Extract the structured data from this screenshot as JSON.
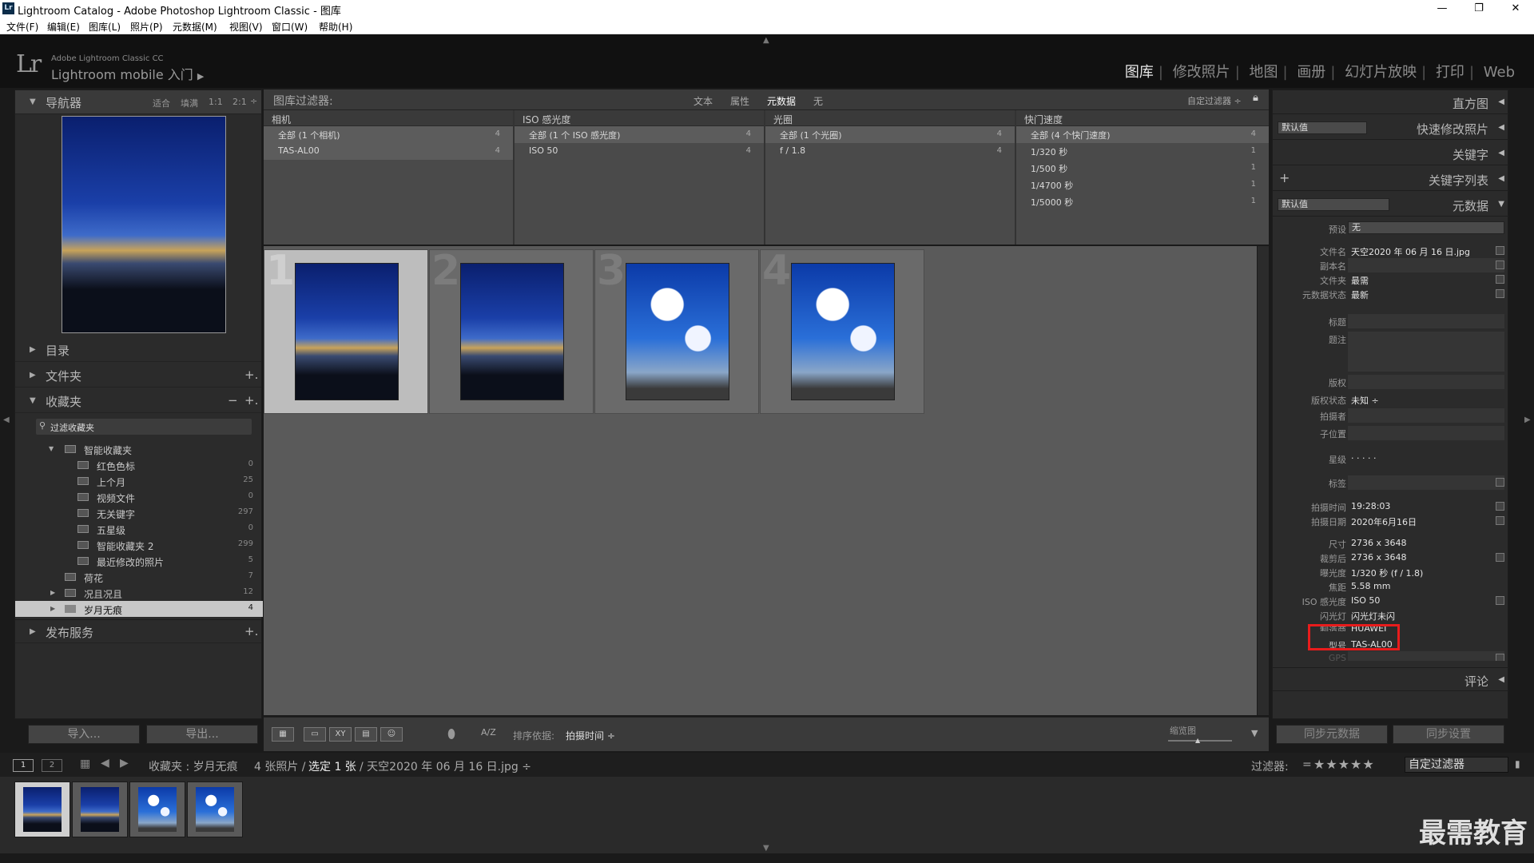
{
  "window": {
    "title": "Lightroom Catalog - Adobe Photoshop Lightroom Classic - 图库",
    "app_badge": "Lr",
    "minimize": "—",
    "restore": "❐",
    "close": "✕"
  },
  "menu": [
    "文件(F)",
    "编辑(E)",
    "图库(L)",
    "照片(P)",
    "元数据(M)",
    "视图(V)",
    "窗口(W)",
    "帮助(H)"
  ],
  "identity": {
    "logo": "Lr",
    "product": "Adobe Lightroom Classic CC",
    "main": "Lightroom mobile 入门",
    "arrow": "▶"
  },
  "modules": [
    "图库",
    "修改照片",
    "地图",
    "画册",
    "幻灯片放映",
    "打印",
    "Web"
  ],
  "modules_sep": "|",
  "left": {
    "navigator": {
      "title": "导航器",
      "zoom": [
        "适合",
        "填满",
        "1:1",
        "2:1"
      ],
      "zoom_arrow": "÷"
    },
    "catalog": "目录",
    "folders": "文件夹",
    "collections": "收藏夹",
    "collections_actions": [
      "−",
      "+."
    ],
    "folders_add": "+.",
    "filter_placeholder": "过滤收藏夹",
    "smart_group": "智能收藏夹",
    "smart_items": [
      {
        "label": "红色色标",
        "count": "0"
      },
      {
        "label": "上个月",
        "count": "25"
      },
      {
        "label": "视频文件",
        "count": "0"
      },
      {
        "label": "无关键字",
        "count": "297"
      },
      {
        "label": "五星级",
        "count": "0"
      },
      {
        "label": "智能收藏夹 2",
        "count": "299"
      },
      {
        "label": "最近修改的照片",
        "count": "5"
      }
    ],
    "other_items": [
      {
        "label": "荷花",
        "count": "7"
      },
      {
        "label": "况且况且",
        "count": "12"
      },
      {
        "label": "岁月无痕",
        "count": "4"
      }
    ],
    "publish": "发布服务",
    "publish_add": "+.",
    "import_btn": "导入...",
    "export_btn": "导出..."
  },
  "filter": {
    "title": "图库过滤器:",
    "tabs": [
      "文本",
      "属性",
      "元数据",
      "无"
    ],
    "custom": "自定过滤器 ÷",
    "columns": [
      {
        "head": "相机",
        "items": [
          {
            "label": "全部 (1 个相机)",
            "count": "4"
          },
          {
            "label": "TAS-AL00",
            "count": "4"
          }
        ]
      },
      {
        "head": "ISO 感光度",
        "items": [
          {
            "label": "全部 (1 个 ISO 感光度)",
            "count": "4"
          },
          {
            "label": "ISO 50",
            "count": "4"
          }
        ]
      },
      {
        "head": "光圈",
        "items": [
          {
            "label": "全部 (1 个光圈)",
            "count": "4"
          },
          {
            "label": "f / 1.8",
            "count": "4"
          }
        ]
      },
      {
        "head": "快门速度",
        "items": [
          {
            "label": "全部 (4 个快门速度)",
            "count": "4"
          },
          {
            "label": "1/320 秒",
            "count": "1"
          },
          {
            "label": "1/500 秒",
            "count": "1"
          },
          {
            "label": "1/4700 秒",
            "count": "1"
          },
          {
            "label": "1/5000 秒",
            "count": "1"
          }
        ]
      }
    ]
  },
  "grid": {
    "cells": [
      {
        "num": "1"
      },
      {
        "num": "2"
      },
      {
        "num": "3"
      },
      {
        "num": "4"
      }
    ]
  },
  "toolbar": {
    "sort_label": "排序依据:",
    "sort_value": "拍摄时间 ÷",
    "thumbs_label": "缩览图",
    "view_compare": "XY",
    "sort_icon": "A/Z"
  },
  "right": {
    "histogram": "直方图",
    "quick_develop": "快速修改照片",
    "default_value": "默认值",
    "keywords": "关键字",
    "keyword_list": "关键字列表",
    "keyword_add": "+",
    "metadata": "元数据",
    "preset_label": "预设",
    "preset_value": "无",
    "rows": [
      {
        "k": "文件名",
        "v": "天空2020 年 06 月 16 日.jpg"
      },
      {
        "k": "副本名",
        "v": ""
      },
      {
        "k": "文件夹",
        "v": "最需"
      },
      {
        "k": "元数据状态",
        "v": "最新"
      },
      {
        "k": "标题",
        "v": ""
      },
      {
        "k": "题注",
        "v": ""
      },
      {
        "k": "版权",
        "v": ""
      },
      {
        "k": "版权状态",
        "v": "未知 ÷"
      },
      {
        "k": "拍摄者",
        "v": ""
      },
      {
        "k": "子位置",
        "v": ""
      },
      {
        "k": "星级",
        "v": "·  ·  ·  ·  ·"
      },
      {
        "k": "标签",
        "v": ""
      },
      {
        "k": "拍摄时间",
        "v": "19:28:03"
      },
      {
        "k": "拍摄日期",
        "v": "2020年6月16日"
      },
      {
        "k": "尺寸",
        "v": "2736 x 3648"
      },
      {
        "k": "裁剪后",
        "v": "2736 x 3648"
      },
      {
        "k": "曝光度",
        "v": "1/320 秒 (f / 1.8)"
      },
      {
        "k": "焦距",
        "v": "5.58 mm"
      },
      {
        "k": "ISO 感光度",
        "v": "ISO 50"
      },
      {
        "k": "闪光灯",
        "v": "闪光灯未闪"
      },
      {
        "k": "制造商",
        "v": "HUAWEI"
      },
      {
        "k": "型号",
        "v": "TAS-AL00"
      },
      {
        "k": "GPS",
        "v": ""
      }
    ],
    "comments": "评论",
    "sync_meta": "同步元数据",
    "sync_settings": "同步设置"
  },
  "stripbar": {
    "page1": "1",
    "page2": "2",
    "source": "收藏夹 : 岁月无痕",
    "count_text": "4 张照片 /",
    "selected_text": "选定 1 张",
    "file_text": "/ 天空2020 年 06 月 16 日.jpg ÷",
    "filter_label": "过滤器:",
    "filter_eq": "=",
    "stars": "★★★★★",
    "filter_value": "自定过滤器"
  },
  "watermark": "最需教育",
  "colors": {
    "highlight": "#e81c1c",
    "active_module": "#e6e6e6"
  }
}
